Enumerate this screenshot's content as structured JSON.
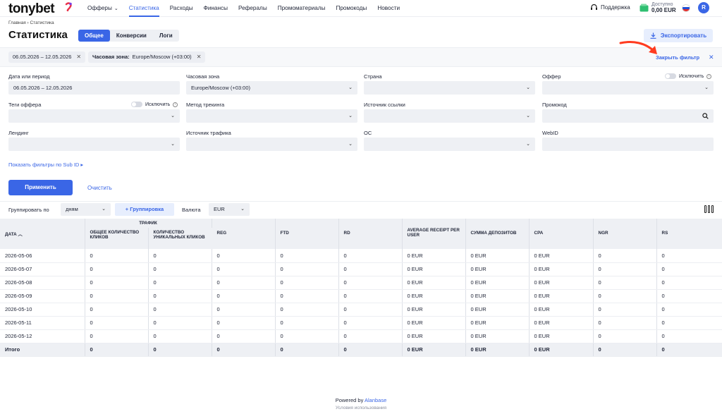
{
  "brand": {
    "logo": "tonybet"
  },
  "nav": {
    "items": [
      {
        "label": "Офферы",
        "caret": true
      },
      {
        "label": "Статистика",
        "active": true
      },
      {
        "label": "Расходы"
      },
      {
        "label": "Финансы"
      },
      {
        "label": "Рефералы"
      },
      {
        "label": "Промоматериалы"
      },
      {
        "label": "Промокоды"
      },
      {
        "label": "Новости"
      }
    ],
    "support": "Поддержка",
    "balance_label": "Доступно",
    "balance_value": "0,00 EUR",
    "user_initial": "R"
  },
  "header": {
    "breadcrumb": "Главная › Статистика",
    "title": "Статистика",
    "tabs": [
      "Общее",
      "Конверсии",
      "Логи"
    ],
    "export": "Экспортировать"
  },
  "chips": {
    "period": "06.05.2026 – 12.05.2026",
    "tz_key": "Часовая зона:",
    "tz_value": "Europe/Moscow (+03:00)",
    "close_filter": "Закрыть фильтр"
  },
  "filters": {
    "date_label": "Дата или период",
    "date_value": "06.05.2026 – 12.05.2026",
    "tz_label": "Часовая зона",
    "tz_value": "Europe/Moscow (+03:00)",
    "country_label": "Страна",
    "offer_label": "Оффер",
    "exclude": "Исключить",
    "offer_tags_label": "Теги оффера",
    "tracking_label": "Метод трекинга",
    "link_source_label": "Источник ссылки",
    "promo_label": "Промокод",
    "landing_label": "Лендинг",
    "traffic_source_label": "Источник трафика",
    "os_label": "ОС",
    "webid_label": "WebID",
    "subid_link": "Показать фильтры по Sub ID ▸",
    "apply": "Применить",
    "clear": "Очистить"
  },
  "grouping": {
    "group_by_label": "Группировать по",
    "group_by_value": "дням",
    "add_group": "+ Группировка",
    "currency_label": "Валюта",
    "currency_value": "EUR"
  },
  "table": {
    "group_header": "Трафик",
    "columns": [
      "Дата ︿",
      "Общее количество кликов",
      "Количество уникальных кликов",
      "REG",
      "FTD",
      "RD",
      "Average receipt per user",
      "Сумма депозитов",
      "CPA",
      "NGR",
      "RS"
    ],
    "rows": [
      [
        "2026-05-06",
        "0",
        "0",
        "0",
        "0",
        "0",
        "0 EUR",
        "0 EUR",
        "0 EUR",
        "0",
        "0"
      ],
      [
        "2026-05-07",
        "0",
        "0",
        "0",
        "0",
        "0",
        "0 EUR",
        "0 EUR",
        "0 EUR",
        "0",
        "0"
      ],
      [
        "2026-05-08",
        "0",
        "0",
        "0",
        "0",
        "0",
        "0 EUR",
        "0 EUR",
        "0 EUR",
        "0",
        "0"
      ],
      [
        "2026-05-09",
        "0",
        "0",
        "0",
        "0",
        "0",
        "0 EUR",
        "0 EUR",
        "0 EUR",
        "0",
        "0"
      ],
      [
        "2026-05-10",
        "0",
        "0",
        "0",
        "0",
        "0",
        "0 EUR",
        "0 EUR",
        "0 EUR",
        "0",
        "0"
      ],
      [
        "2026-05-11",
        "0",
        "0",
        "0",
        "0",
        "0",
        "0 EUR",
        "0 EUR",
        "0 EUR",
        "0",
        "0"
      ],
      [
        "2026-05-12",
        "0",
        "0",
        "0",
        "0",
        "0",
        "0 EUR",
        "0 EUR",
        "0 EUR",
        "0",
        "0"
      ]
    ],
    "total": [
      "Итого",
      "0",
      "0",
      "0",
      "0",
      "0",
      "0 EUR",
      "0 EUR",
      "0 EUR",
      "0",
      "0"
    ]
  },
  "footer": {
    "powered_by": "Powered by",
    "powered_brand": "Alanbase",
    "terms": "Условия использования"
  },
  "colors": {
    "accent": "#3a66e6",
    "arrow": "#ff3b1f",
    "field_bg": "#eef0f4"
  }
}
